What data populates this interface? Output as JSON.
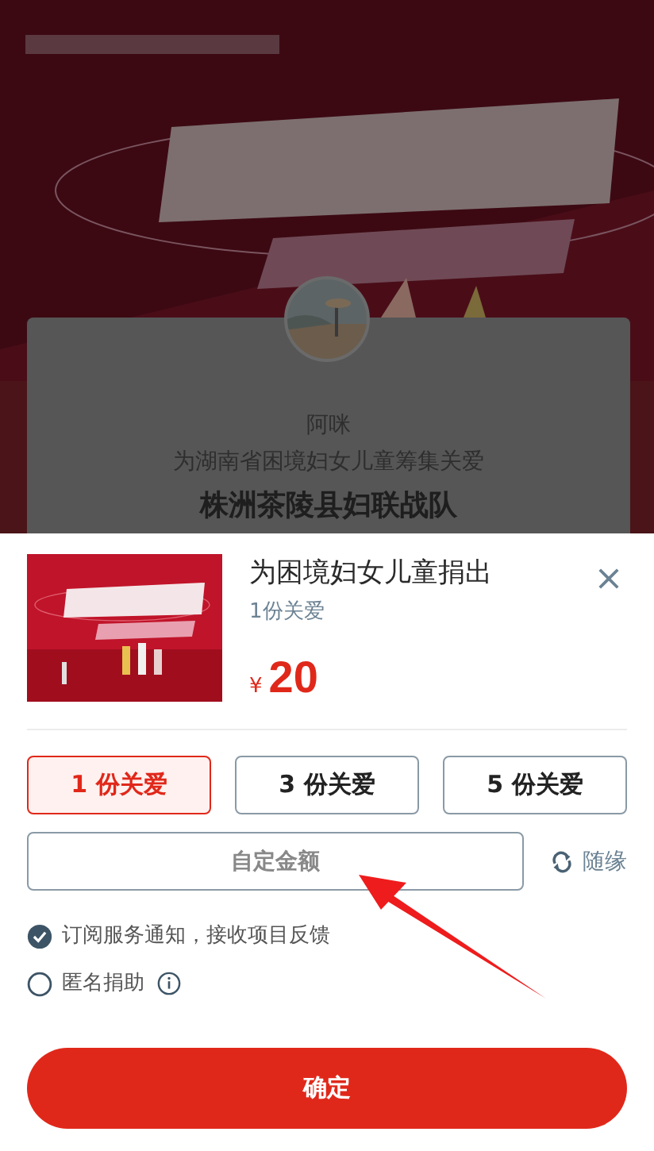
{
  "background": {
    "card": {
      "name": "阿咪",
      "subtitle": "为湖南省困境妇女儿童筹集关爱",
      "team": "株洲茶陵县妇联战队"
    }
  },
  "donation": {
    "title": "为困境妇女儿童捐出",
    "unit": "1份关爱",
    "currency": "¥",
    "amount": "20"
  },
  "options": [
    {
      "label": "1 份关爱",
      "selected": true
    },
    {
      "label": "3 份关爱",
      "selected": false
    },
    {
      "label": "5 份关爱",
      "selected": false
    }
  ],
  "custom_amount": "自定金额",
  "random": "随缘",
  "toggles": [
    {
      "label": "订阅服务通知，接收项目反馈",
      "checked": true,
      "info": false
    },
    {
      "label": "匿名捐助",
      "checked": false,
      "info": true
    }
  ],
  "confirm": "确定"
}
